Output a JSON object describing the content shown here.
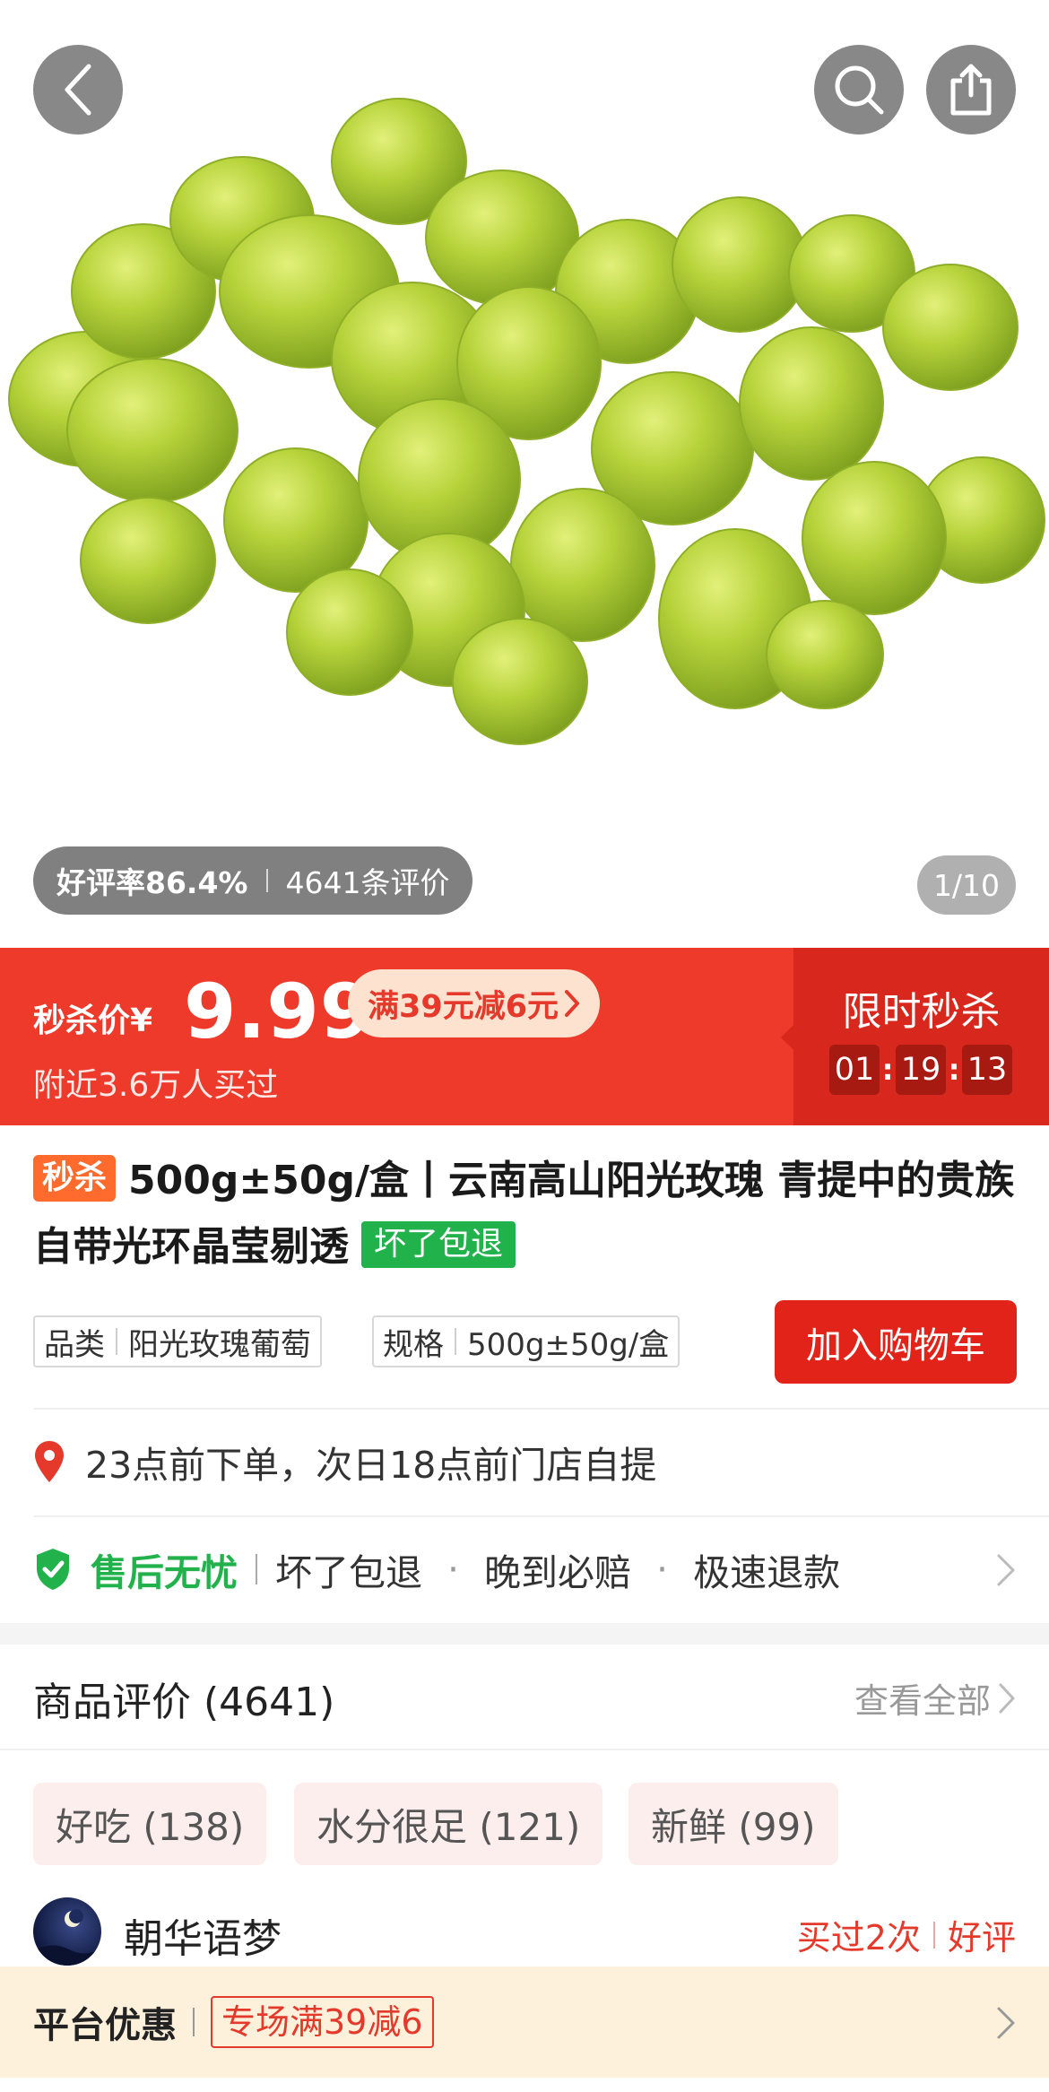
{
  "header": {
    "back_icon": "chevron-left-icon",
    "search_icon": "search-icon",
    "share_icon": "share-icon"
  },
  "gallery": {
    "rating_text": "好评率86.4%",
    "review_count_text": "4641条评价",
    "page_indicator": "1/10"
  },
  "price_bar": {
    "label": "秒杀价",
    "currency": "¥",
    "price": "9.99",
    "coupon": "满39元减6元",
    "sold": "附近3.6万人买过",
    "flash_title": "限时秒杀",
    "countdown": {
      "hours": "01",
      "minutes": "19",
      "seconds": "13"
    },
    "colors": {
      "bar": "#ee3a2b",
      "right_panel": "#d8271c"
    }
  },
  "product": {
    "flash_tag": "秒杀",
    "title": "500g±50g/盒丨云南高山阳光玫瑰 青提中的贵族自带光环晶莹剔透",
    "refund_tag": "坏了包退"
  },
  "specs": {
    "category_label": "品类",
    "category_value": "阳光玫瑰葡萄",
    "size_label": "规格",
    "size_value": "500g±50g/盒",
    "add_to_cart": "加入购物车"
  },
  "pickup": {
    "icon": "location-pin-icon",
    "text": "23点前下单，次日18点前门店自提"
  },
  "after_sales": {
    "icon": "shield-check-icon",
    "title": "售后无忧",
    "items": [
      "坏了包退",
      "晚到必赔",
      "极速退款"
    ]
  },
  "reviews": {
    "title": "商品评价 (4641)",
    "view_all": "查看全部",
    "chips": [
      "好吃 (138)",
      "水分很足 (121)",
      "新鲜 (99)"
    ],
    "reviewer_name": "朝华语梦",
    "bought_times": "买过2次",
    "rating_label": "好评"
  },
  "promo": {
    "label": "平台优惠",
    "tag": "专场满39减6"
  }
}
